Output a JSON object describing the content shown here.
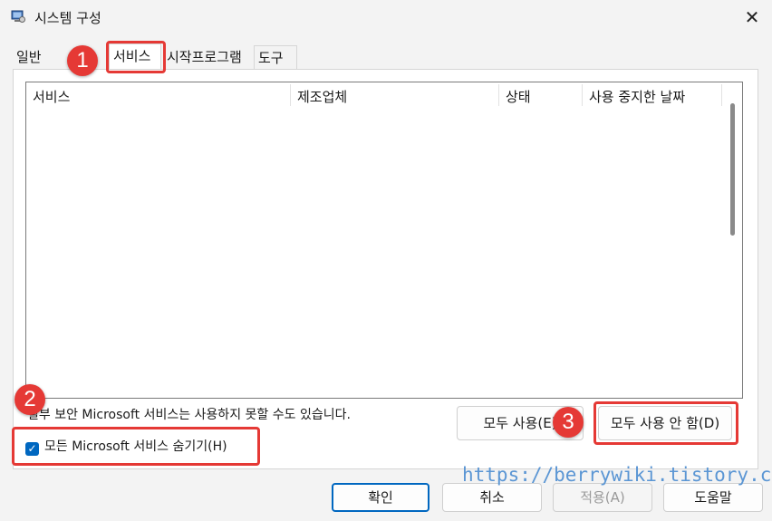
{
  "window": {
    "title": "시스템 구성",
    "close_glyph": "✕"
  },
  "tabs": [
    {
      "label": "일반"
    },
    {
      "label": "서비스"
    },
    {
      "label": "시작프로그램"
    },
    {
      "label": "도구"
    }
  ],
  "services": {
    "columns": [
      "서비스",
      "제조업체",
      "상태",
      "사용 중지한 날짜"
    ],
    "rows": [],
    "note": "일부 보안 Microsoft 서비스는 사용하지 못할 수도 있습니다.",
    "enable_all_label": "모두 사용(E)",
    "disable_all_label": "모두 사용 안 함(D)",
    "hide_ms_label": "모든 Microsoft 서비스 숨기기(H)",
    "hide_ms_checked": true
  },
  "buttons": {
    "ok": "확인",
    "cancel": "취소",
    "apply": "적용(A)",
    "help": "도움말"
  },
  "annotations": {
    "badge1": "1",
    "badge2": "2",
    "badge3": "3"
  },
  "watermark": "https://berrywiki.tistory.com",
  "colors": {
    "accent": "#0067c0",
    "annotation": "#e53935",
    "watermark": "#5b96d4"
  }
}
